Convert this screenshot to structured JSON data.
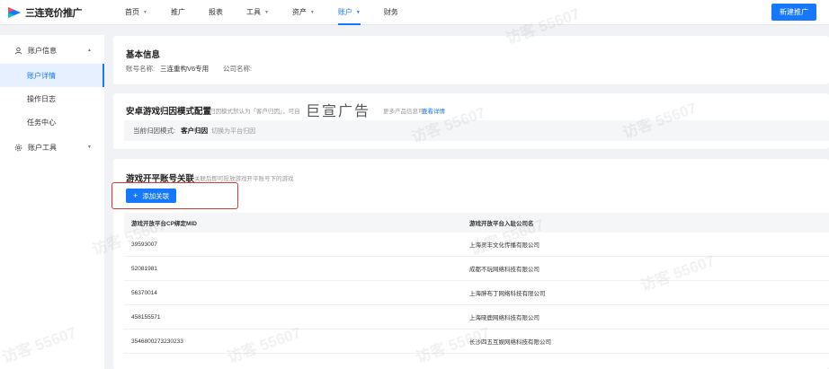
{
  "brand": {
    "name": "三连竞价推广"
  },
  "nav": [
    {
      "label": "首页",
      "caret": true,
      "active": false
    },
    {
      "label": "推广",
      "caret": false,
      "active": false
    },
    {
      "label": "报表",
      "caret": false,
      "active": false
    },
    {
      "label": "工具",
      "caret": true,
      "active": false
    },
    {
      "label": "资产",
      "caret": true,
      "active": false
    },
    {
      "label": "账户",
      "caret": true,
      "active": true
    },
    {
      "label": "财务",
      "caret": false,
      "active": false
    }
  ],
  "header": {
    "new_button": "新建推广"
  },
  "sidebar": {
    "group1": "账户信息",
    "items": [
      "账户详情",
      "操作日志",
      "任务中心"
    ],
    "group2": "账户工具"
  },
  "basic": {
    "title": "基本信息",
    "account_label": "账号名称:",
    "account_value": "三连重构V6专用",
    "company_label": "公司名称:"
  },
  "attribution": {
    "title": "安卓游戏归因模式配置",
    "hint_a": "归因模式默认为「客户归因」，可自",
    "hint_b": "更多产品信息可",
    "hint_link": "查看详情",
    "mode_label": "当前归因模式:",
    "mode_value": "客户归因",
    "switch_text": "切换为平台归因"
  },
  "linking": {
    "title": "游戏开平账号关联",
    "hint": "关联后即可投放游戏开平账号下的游戏",
    "add_button": "添加关联",
    "columns": [
      "游戏开放平台CP绑定MID",
      "游戏开放平台入驻公司名"
    ],
    "rows": [
      [
        "39593007",
        "上海灵丰文化传播有限公司"
      ],
      [
        "52081981",
        "成都不玩网络科技有限公司"
      ],
      [
        "56370014",
        "上海胖布丁网络科技有限公司"
      ],
      [
        "458155571",
        "上海晓鹿网络科技有限公司"
      ],
      [
        "3546800273230233",
        "长沙四五互娱网络科技有限公司"
      ]
    ]
  },
  "watermark": "访客 55607",
  "overlay_text": "巨宣广告",
  "colors": {
    "accent": "#1677ff",
    "highlight": "#d63b3b"
  }
}
